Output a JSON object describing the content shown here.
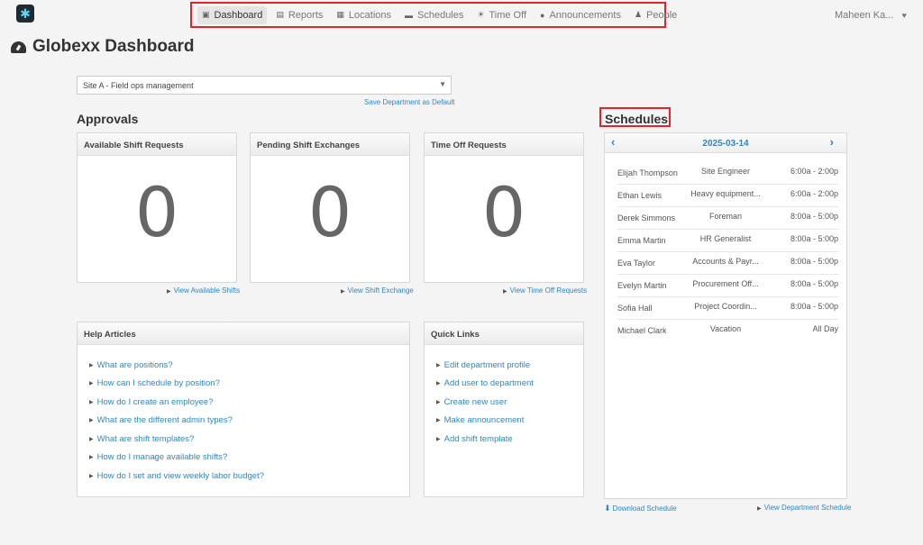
{
  "nav": {
    "items": [
      {
        "label": "Dashboard",
        "icon": "inbox-icon",
        "glyph": "▣",
        "active": true
      },
      {
        "label": "Reports",
        "icon": "chart-icon",
        "glyph": "▤",
        "active": false
      },
      {
        "label": "Locations",
        "icon": "building-icon",
        "glyph": "▦",
        "active": false
      },
      {
        "label": "Schedules",
        "icon": "calendar-icon",
        "glyph": "▬",
        "active": false
      },
      {
        "label": "Time Off",
        "icon": "sun-icon",
        "glyph": "☀",
        "active": false
      },
      {
        "label": "Announcements",
        "icon": "comment-icon",
        "glyph": "●",
        "active": false
      },
      {
        "label": "People",
        "icon": "users-icon",
        "glyph": "♟",
        "active": false
      }
    ],
    "user": "Maheen Ka...",
    "user_icon": "heart-icon"
  },
  "page": {
    "title": "Globexx Dashboard"
  },
  "department": {
    "selected": "Site A - Field ops management",
    "save_default": "Save Department as Default"
  },
  "approvals": {
    "heading": "Approvals",
    "cards": [
      {
        "title": "Available Shift Requests",
        "count": "0",
        "link": "View Available Shifts"
      },
      {
        "title": "Pending Shift Exchanges",
        "count": "0",
        "link": "View Shift Exchange"
      },
      {
        "title": "Time Off Requests",
        "count": "0",
        "link": "View Time Off Requests"
      }
    ]
  },
  "help": {
    "title": "Help Articles",
    "items": [
      "What are positions?",
      "How can I schedule by position?",
      "How do I create an employee?",
      "What are the different admin types?",
      "What are shift templates?",
      "How do I manage available shifts?",
      "How do I set and view weekly labor budget?"
    ]
  },
  "quick_links": {
    "title": "Quick Links",
    "items": [
      "Edit department profile",
      "Add user to department",
      "Create new user",
      "Make announcement",
      "Add shift template"
    ]
  },
  "schedules": {
    "heading": "Schedules",
    "date": "2025-03-14",
    "rows": [
      {
        "name": "Elijah Thompson",
        "position": "Site Engineer",
        "time": "6:00a - 2:00p"
      },
      {
        "name": "Ethan Lewis",
        "position": "Heavy equipment...",
        "time": "6:00a - 2:00p"
      },
      {
        "name": "Derek Simmons",
        "position": "Foreman",
        "time": "8:00a - 5:00p"
      },
      {
        "name": "Emma Martin",
        "position": "HR Generalist",
        "time": "8:00a - 5:00p"
      },
      {
        "name": "Eva Taylor",
        "position": "Accounts & Payr...",
        "time": "8:00a - 5:00p"
      },
      {
        "name": "Evelyn Martin",
        "position": "Procurement Off...",
        "time": "8:00a - 5:00p"
      },
      {
        "name": "Sofia Hall",
        "position": "Project Coordin...",
        "time": "8:00a - 5:00p"
      },
      {
        "name": "Michael Clark",
        "position": "Vacation",
        "time": "All Day"
      }
    ],
    "download": "Download Schedule",
    "view_department": "View Department Schedule"
  }
}
